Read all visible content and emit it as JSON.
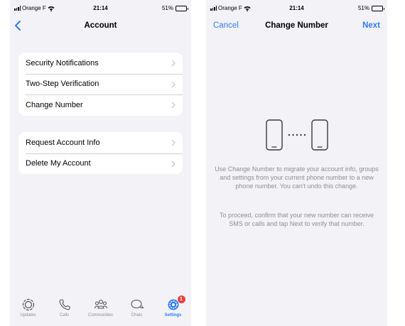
{
  "status_bar": {
    "carrier": "Orange F",
    "time": "21:14",
    "battery": "51%",
    "battery_level": 0.51
  },
  "account_screen": {
    "title": "Account",
    "groups": [
      {
        "items": [
          {
            "label": "Security Notifications"
          },
          {
            "label": "Two-Step Verification"
          },
          {
            "label": "Change Number"
          }
        ]
      },
      {
        "items": [
          {
            "label": "Request Account Info"
          },
          {
            "label": "Delete My Account"
          }
        ]
      }
    ],
    "tab_bar": {
      "tabs": [
        {
          "label": "Updates",
          "icon": "updates-icon"
        },
        {
          "label": "Calls",
          "icon": "phone-icon"
        },
        {
          "label": "Communities",
          "icon": "communities-icon"
        },
        {
          "label": "Chats",
          "icon": "chats-icon"
        },
        {
          "label": "Settings",
          "icon": "settings-icon",
          "active": true,
          "badge": "1"
        }
      ]
    }
  },
  "change_number_screen": {
    "cancel_label": "Cancel",
    "title": "Change Number",
    "next_label": "Next",
    "paragraph_1": "Use Change Number to migrate your account info, groups and settings from your current phone number to a new phone number. You can't undo this change.",
    "paragraph_2": "To proceed, confirm that your new number can receive SMS or calls and tap Next to verify that number."
  },
  "colors": {
    "accent": "#2f7bf4",
    "background": "#f2f2f7",
    "secondary_text": "#8e8e93",
    "badge": "#e8423f"
  }
}
